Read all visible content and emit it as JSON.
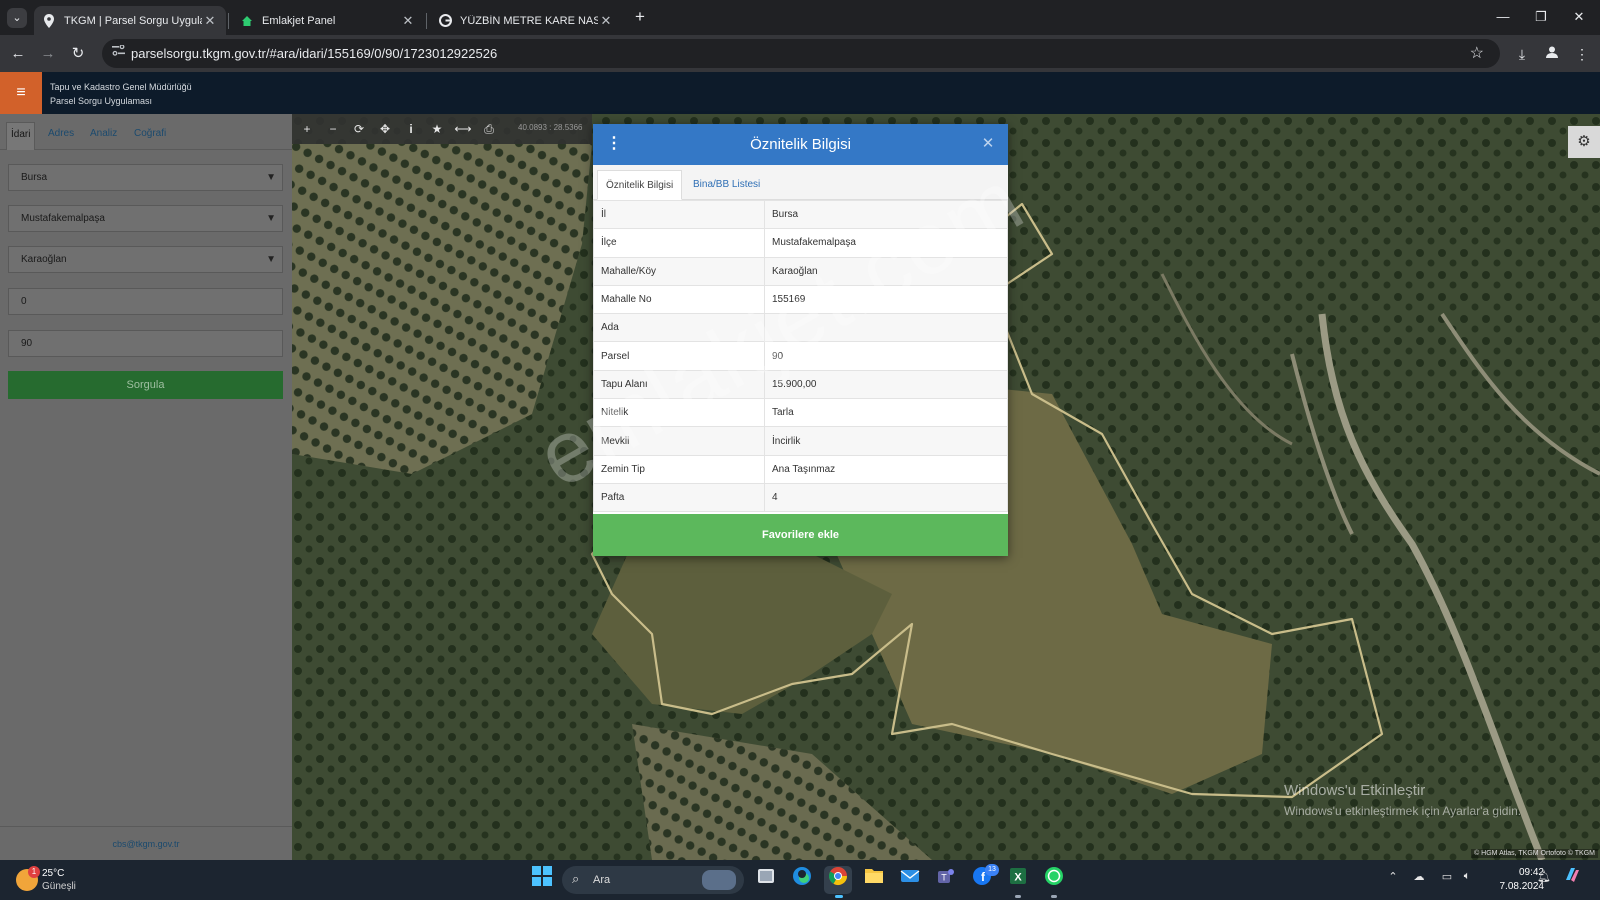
{
  "browser": {
    "tabs": [
      {
        "title": "TKGM | Parsel Sorgu Uygulaması",
        "active": true,
        "icon": "map-pin-icon"
      },
      {
        "title": "Emlakjet Panel",
        "active": false,
        "icon": "home-icon"
      },
      {
        "title": "YÜZBİN METRE KARE NASIL YA",
        "active": false,
        "icon": "google-icon"
      }
    ],
    "url": "parselsorgu.tkgm.gov.tr/#ara/idari/155169/0/90/1723012922526"
  },
  "app": {
    "title_line1": "Tapu ve Kadastro Genel Müdürlüğü",
    "title_line2": "Parsel Sorgu Uygulaması"
  },
  "sidebar": {
    "tabs": [
      "İdari",
      "Adres",
      "Analiz",
      "Coğrafi"
    ],
    "il": "Bursa",
    "ilce": "Mustafakemalpaşa",
    "mahalle": "Karaoğlan",
    "ada": "0",
    "parsel": "90",
    "query_button": "Sorgula",
    "footer_email": "cbs@tkgm.gov.tr"
  },
  "map": {
    "coords": "40.0893 : 28.5366",
    "attribution": "© HGM Atlas, TKGM Ortofoto © TKGM",
    "activation_title": "Windows'u Etkinleştir",
    "activation_sub": "Windows'u etkinleştirmek için Ayarlar'a gidin."
  },
  "modal": {
    "title": "Öznitelik Bilgisi",
    "tabs": [
      "Öznitelik Bilgisi",
      "Bina/BB Listesi"
    ],
    "rows": [
      {
        "k": "İl",
        "v": "Bursa"
      },
      {
        "k": "İlçe",
        "v": "Mustafakemalpaşa"
      },
      {
        "k": "Mahalle/Köy",
        "v": "Karaoğlan"
      },
      {
        "k": "Mahalle No",
        "v": "155169"
      },
      {
        "k": "Ada",
        "v": ""
      },
      {
        "k": "Parsel",
        "v": "90"
      },
      {
        "k": "Tapu Alanı",
        "v": "15.900,00"
      },
      {
        "k": "Nitelik",
        "v": "Tarla"
      },
      {
        "k": "Mevkii",
        "v": "İncirlik"
      },
      {
        "k": "Zemin Tip",
        "v": "Ana Taşınmaz"
      },
      {
        "k": "Pafta",
        "v": "4"
      }
    ],
    "favorite_button": "Favorilere ekle"
  },
  "watermark": "emlakjet.com",
  "taskbar": {
    "weather_temp": "25°C",
    "weather_desc": "Güneşli",
    "weather_badge": "1",
    "search_text": "Ara",
    "notif_badge": "13",
    "time": "09:42",
    "date": "7.08.2024"
  },
  "colors": {
    "modal_header": "#3478c6",
    "favorite_button": "#5cb85c",
    "query_button": "#266b2f",
    "app_header": "#0d1b2a",
    "menu_button": "#d2612a"
  }
}
